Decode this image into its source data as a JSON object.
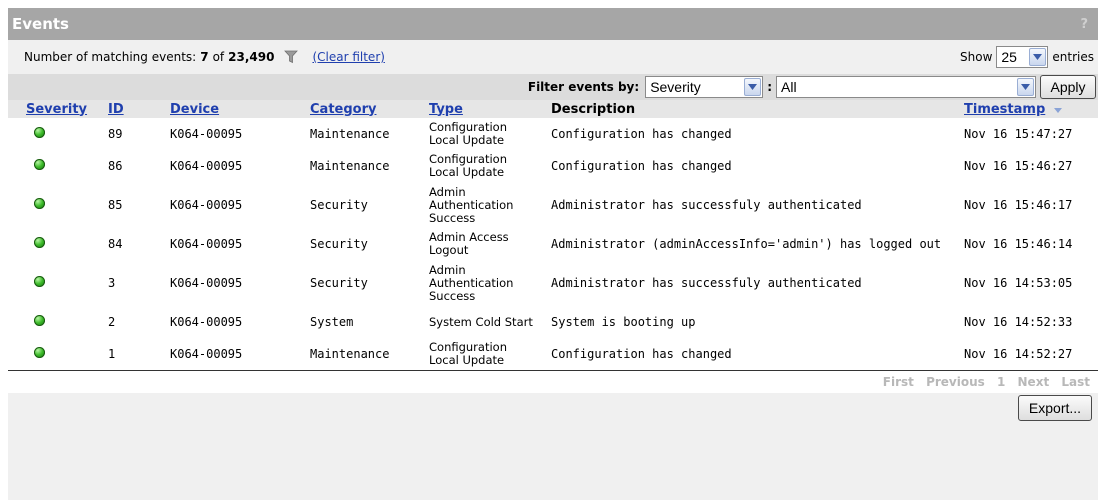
{
  "panel": {
    "title": "Events",
    "help": "?"
  },
  "status": {
    "label": "Number of matching events:",
    "matched": "7",
    "of_word": "of",
    "total": "23,490",
    "clear_filter": "(Clear filter)"
  },
  "show": {
    "label": "Show",
    "value": "25",
    "suffix": "entries"
  },
  "filter": {
    "label": "Filter events by:",
    "field_value": "Severity",
    "colon": ":",
    "value": "All",
    "apply_label": "Apply"
  },
  "table": {
    "headers": {
      "severity": "Severity",
      "id": "ID",
      "device": "Device",
      "category": "Category",
      "type": "Type",
      "description": "Description",
      "timestamp": "Timestamp"
    },
    "rows": [
      {
        "severity": "green",
        "id": "89",
        "device": "K064-00095",
        "category": "Maintenance",
        "type": "Configuration Local Update",
        "description": "Configuration has changed",
        "timestamp": "Nov 16 15:47:27"
      },
      {
        "severity": "green",
        "id": "86",
        "device": "K064-00095",
        "category": "Maintenance",
        "type": "Configuration Local Update",
        "description": "Configuration has changed",
        "timestamp": "Nov 16 15:46:27"
      },
      {
        "severity": "green",
        "id": "85",
        "device": "K064-00095",
        "category": "Security",
        "type": "Admin Authentication Success",
        "description": "Administrator has successfuly authenticated",
        "timestamp": "Nov 16 15:46:17"
      },
      {
        "severity": "green",
        "id": "84",
        "device": "K064-00095",
        "category": "Security",
        "type": "Admin Access Logout",
        "description": "Administrator (adminAccessInfo='admin') has logged out",
        "timestamp": "Nov 16 15:46:14"
      },
      {
        "severity": "green",
        "id": "3",
        "device": "K064-00095",
        "category": "Security",
        "type": "Admin Authentication Success",
        "description": "Administrator has successfuly authenticated",
        "timestamp": "Nov 16 14:53:05"
      },
      {
        "severity": "green",
        "id": "2",
        "device": "K064-00095",
        "category": "System",
        "type": "System Cold Start",
        "description": "System is booting up",
        "timestamp": "Nov 16 14:52:33"
      },
      {
        "severity": "green",
        "id": "1",
        "device": "K064-00095",
        "category": "Maintenance",
        "type": "Configuration Local Update",
        "description": "Configuration has changed",
        "timestamp": "Nov 16 14:52:27"
      }
    ]
  },
  "pager": {
    "first": "First",
    "previous": "Previous",
    "page": "1",
    "next": "Next",
    "last": "Last"
  },
  "export_label": "Export...",
  "colors": {
    "title_bar": "#a6a6a6",
    "link": "#1f3fae",
    "severity_ok": "#3dbb2a",
    "pager_disabled": "#b8b8b8"
  }
}
